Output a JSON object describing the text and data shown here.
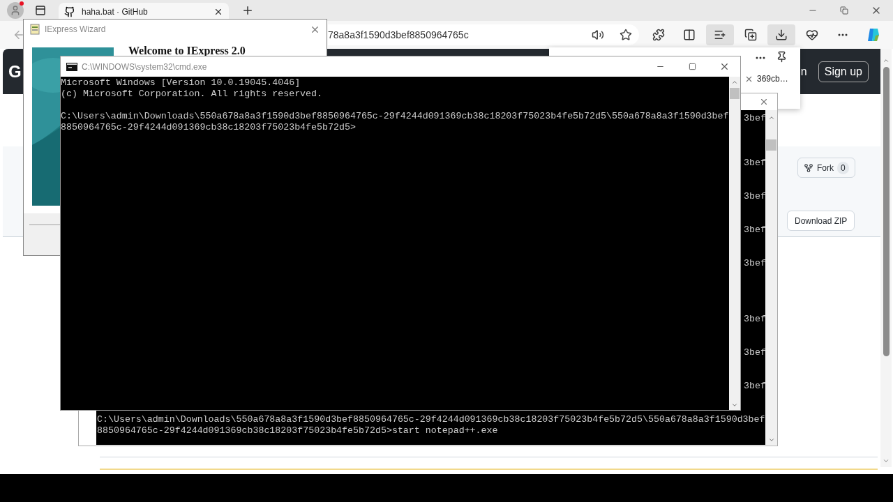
{
  "browser": {
    "tab": {
      "title": "haha.bat · GitHub"
    },
    "address": "78a8a3f1590d3bef8850964765c",
    "address_buttons": [
      {
        "kind": "read-aloud"
      },
      {
        "kind": "favorite"
      }
    ],
    "toolbar_buttons": [
      {
        "kind": "extensions",
        "selected": false
      },
      {
        "kind": "split-screen",
        "selected": false
      },
      {
        "kind": "favorites",
        "selected": true
      },
      {
        "kind": "collections",
        "selected": false
      },
      {
        "kind": "downloads",
        "selected": true
      },
      {
        "kind": "essentials",
        "selected": false
      },
      {
        "kind": "more",
        "selected": false
      },
      {
        "kind": "copilot",
        "selected": false
      }
    ]
  },
  "downloads_panel": {
    "item": "369cb…"
  },
  "github": {
    "logo_partial": "G",
    "sign_in_partial": "n",
    "sign_up": "Sign up",
    "fork": {
      "label": "Fork",
      "count": "0"
    },
    "download_zip": "Download ZIP"
  },
  "iexpress": {
    "title": "IExpress Wizard",
    "heading": "Welcome to IExpress 2.0"
  },
  "cmd_back": {
    "fragments": [
      "3bef",
      "3bef",
      "3bef",
      "3bef",
      "3bef",
      "3bef",
      "3bef",
      "3bef"
    ],
    "lines": [
      "C:\\Users\\admin\\Downloads\\550a678a8a3f1590d3bef8850964765c-29f4244d091369cb38c18203f75023b4fe5b72d5\\550a678a8a3f1590d3bef",
      "8850964765c-29f4244d091369cb38c18203f75023b4fe5b72d5>start notepad++.exe"
    ]
  },
  "cmd_front": {
    "title": "C:\\WINDOWS\\system32\\cmd.exe",
    "blocks": [
      [
        "Microsoft Windows [Version 10.0.19045.4046]",
        "(c) Microsoft Corporation. All rights reserved."
      ],
      [
        "C:\\Users\\admin\\Downloads\\550a678a8a3f1590d3bef8850964765c-29f4244d091369cb38c18203f75023b4fe5b72d5\\550a678a8a3f1590d3bef",
        "8850964765c-29f4244d091369cb38c18203f75023b4fe5b72d5>"
      ]
    ]
  }
}
